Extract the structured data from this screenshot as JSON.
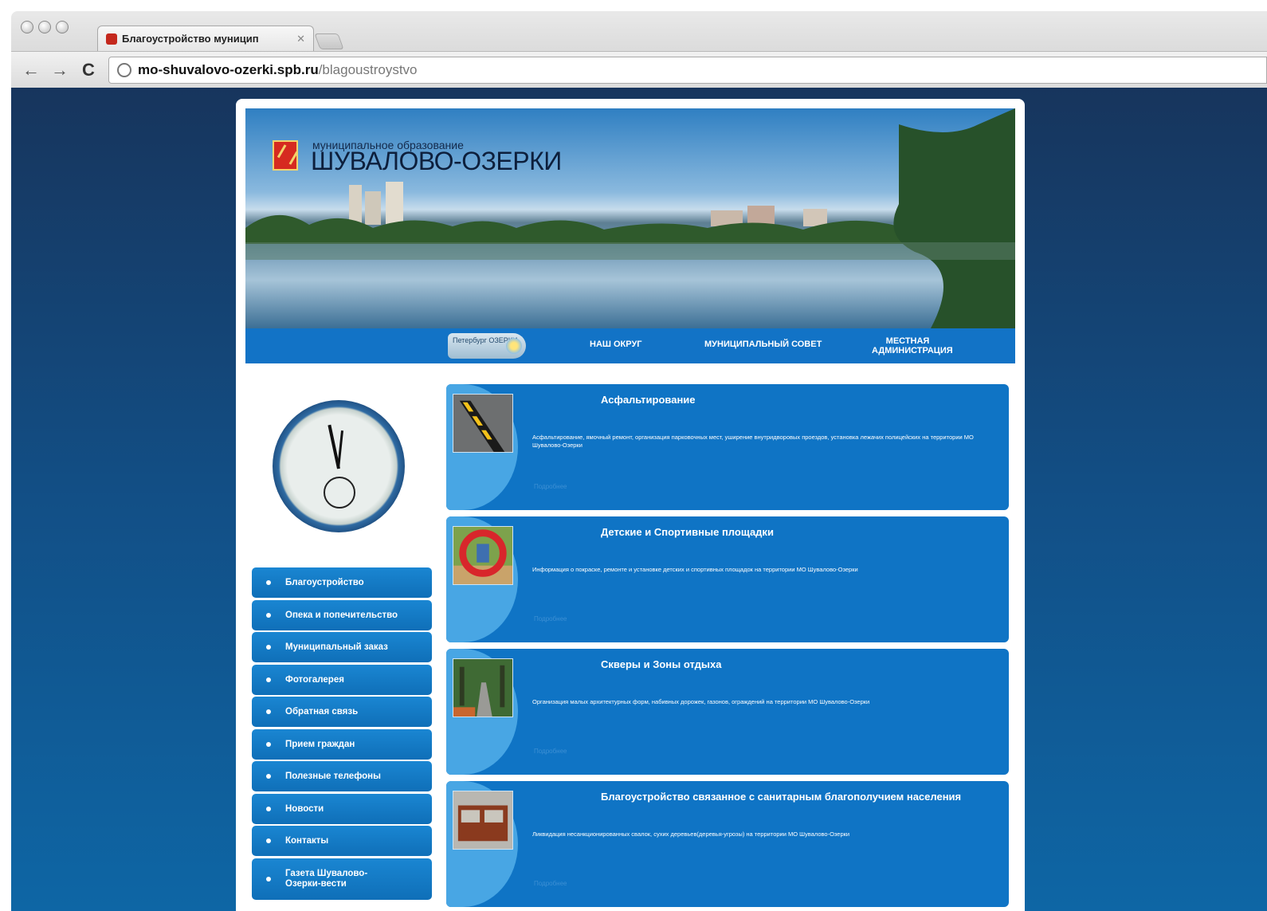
{
  "browser": {
    "tab_title": "Благоустройство муницип",
    "url_host": "mo-shuvalovo-ozerki.spb.ru",
    "url_path": "/blagoustroystvo"
  },
  "header": {
    "subtitle": "муниципальное образование",
    "title": "ШУВАЛОВО-ОЗЕРКИ"
  },
  "topnav": {
    "badge": "Петербург ОЗЕРКИ",
    "items": [
      "НАШ ОКРУГ",
      "МУНИЦИПАЛЬНЫЙ СОВЕТ",
      "МЕСТНАЯ АДМИНИСТРАЦИЯ"
    ]
  },
  "sidebar": {
    "items": [
      "Благоустройство",
      "Опека и попечительство",
      "Муниципальный заказ",
      "Фотогалерея",
      "Обратная связь",
      "Прием граждан",
      "Полезные телефоны",
      "Новости",
      "Контакты",
      "Газета Шувалово-Озерки-вести"
    ]
  },
  "cards": [
    {
      "title": "Асфальтирование",
      "text": "Асфальтирование, ямочный ремонт, организация парковочных мест, уширение внутридворовых проездов, установка лежачих полицейских на территории МО Шувалово-Озерки",
      "more": "Подробнее"
    },
    {
      "title": "Детские и Спортивные площадки",
      "text": "Информация о покраске, ремонте и установке детских и спортивных площадок на территории МО Шувалово-Озерки",
      "more": "Подробнее"
    },
    {
      "title": "Скверы и Зоны отдыха",
      "text": "Организация малых архитектурных форм, набивных дорожек, газонов, ограждений на территории МО Шувалово-Озерки",
      "more": "Подробнее"
    },
    {
      "title": "Благоустройство связанное с санитарным благополучием населения",
      "text": "Ликвидация несанкционированных свалок, сухих деревьев(деревья-угрозы) на территории МО Шувалово-Озерки",
      "more": "Подробнее"
    }
  ],
  "colors": {
    "page_bg": "#124f86",
    "nav_blue": "#1273c6",
    "card_blue": "#0f74c5",
    "card_tab": "#48a6e4"
  }
}
